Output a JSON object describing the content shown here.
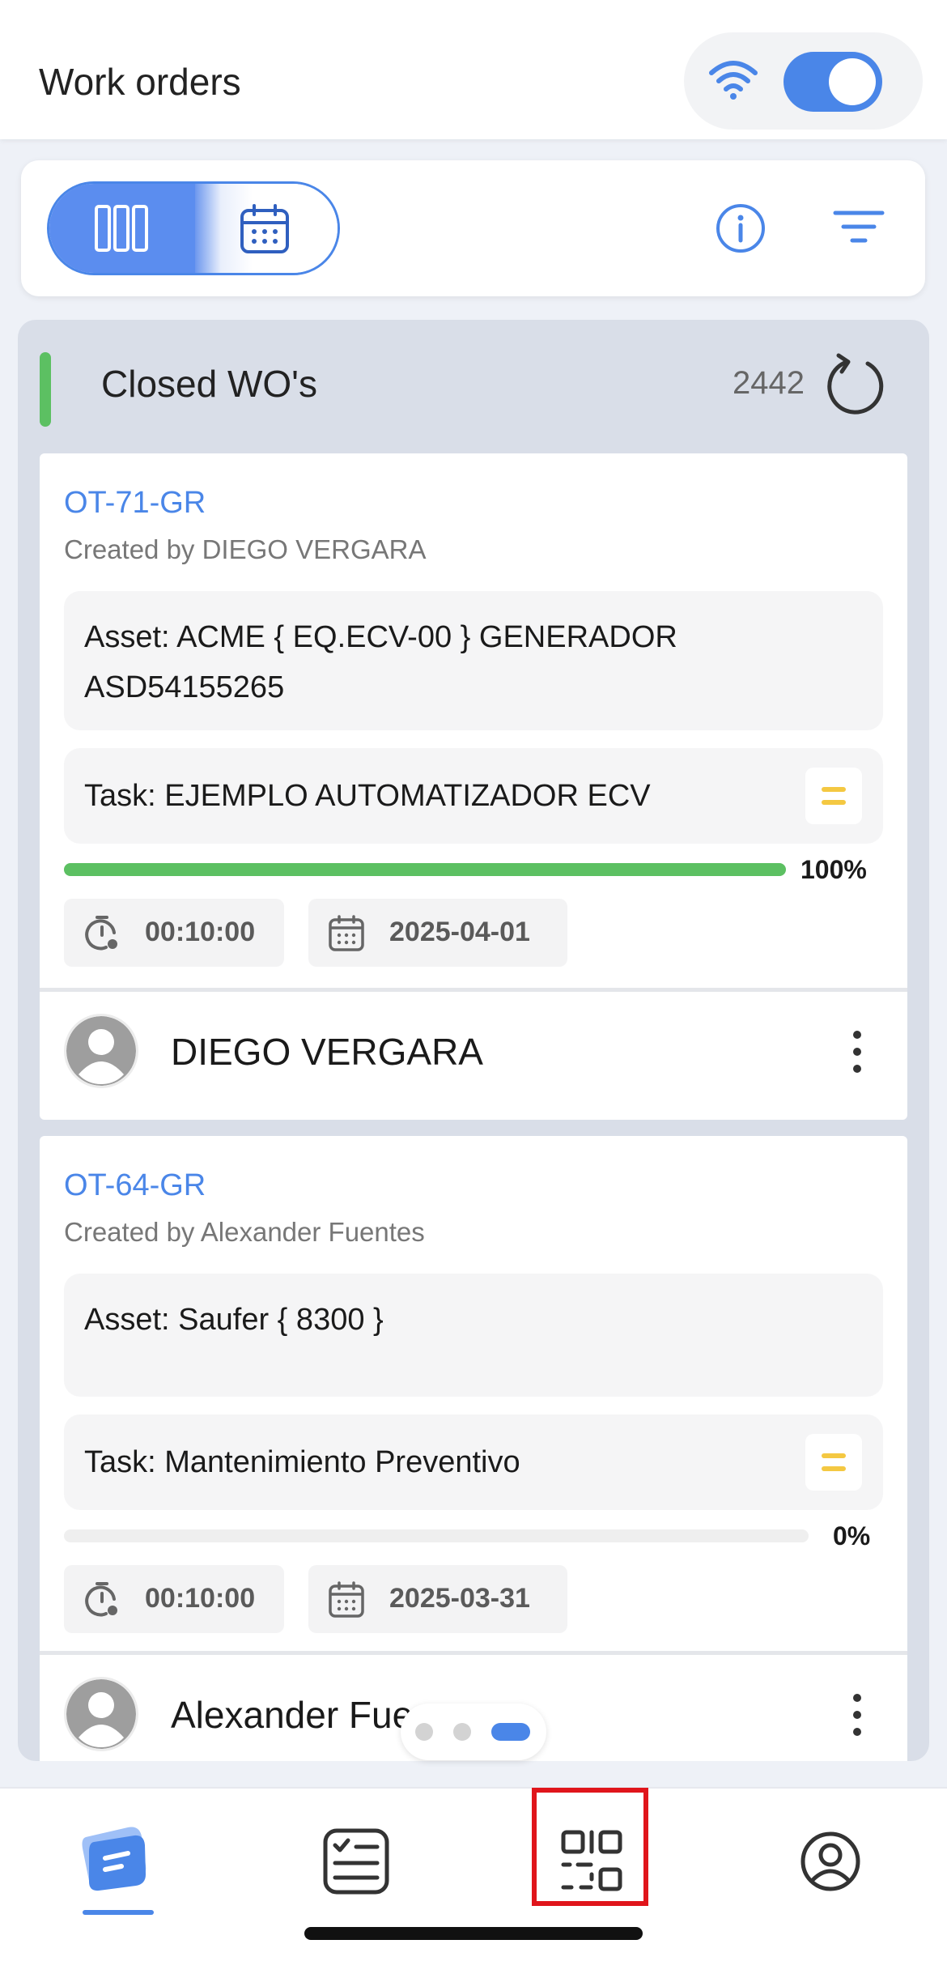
{
  "header": {
    "title": "Work orders"
  },
  "toolbar": {
    "view_kanban": "kanban-view",
    "view_calendar": "calendar-view"
  },
  "column": {
    "title": "Closed WO's",
    "count": "2442",
    "status_color": "#5cc062"
  },
  "cards": [
    {
      "code": "OT-71-GR",
      "created_by": "Created by DIEGO VERGARA",
      "asset_label": "Asset:",
      "asset_value": " ACME { EQ.ECV-00 } GENERADOR ASD54155265",
      "task_label": "Task:",
      "task_value": " EJEMPLO AUTOMATIZADOR ECV",
      "progress": 100,
      "progress_label": "100%",
      "duration": "00:10:00",
      "date": "2025-04-01",
      "assignee": "DIEGO VERGARA"
    },
    {
      "code": "OT-64-GR",
      "created_by": "Created by Alexander Fuentes",
      "asset_label": "Asset:",
      "asset_value": " Saufer { 8300 }",
      "task_label": "Task:",
      "task_value": " Mantenimiento Preventivo",
      "progress": 0,
      "progress_label": "0%",
      "duration": "00:10:00",
      "date": "2025-03-31",
      "assignee": "Alexander Fue..."
    }
  ],
  "pagination": {
    "pages": 3,
    "current": 3
  },
  "nav": [
    {
      "name": "work-orders",
      "icon": "work-orders-icon",
      "active": true
    },
    {
      "name": "checklist",
      "icon": "checklist-icon",
      "active": false
    },
    {
      "name": "qr-scan",
      "icon": "qr-code-icon",
      "active": false
    },
    {
      "name": "profile",
      "icon": "profile-icon",
      "active": false
    }
  ],
  "colors": {
    "accent": "#4a86e8",
    "success": "#5cc062",
    "priority": "#f4c842",
    "highlight": "#e0151b"
  }
}
